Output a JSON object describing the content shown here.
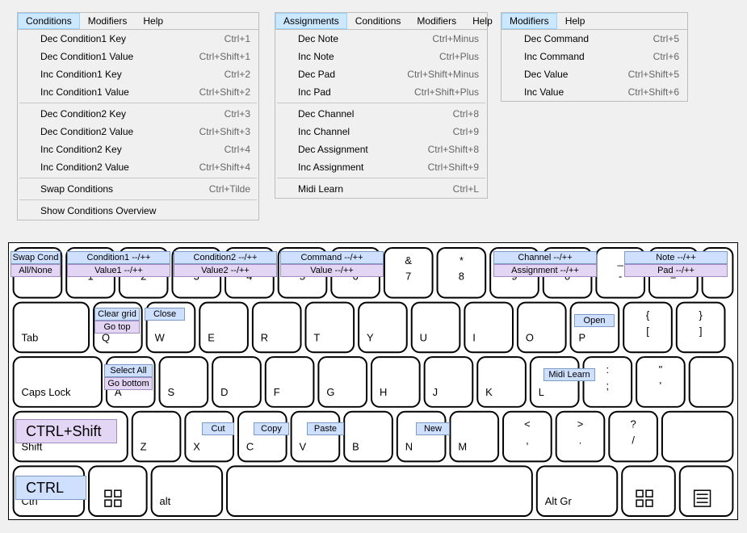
{
  "menus": {
    "conditions": {
      "bar": [
        "Conditions",
        "Modifiers",
        "Help"
      ],
      "selected": 0,
      "items": [
        {
          "label": "Dec Condition1 Key",
          "shortcut": "Ctrl+1"
        },
        {
          "label": "Dec Condition1 Value",
          "shortcut": "Ctrl+Shift+1"
        },
        {
          "label": "Inc Condition1 Key",
          "shortcut": "Ctrl+2"
        },
        {
          "label": "Inc Condition1 Value",
          "shortcut": "Ctrl+Shift+2"
        },
        {
          "sep": true
        },
        {
          "label": "Dec Condition2 Key",
          "shortcut": "Ctrl+3"
        },
        {
          "label": "Dec Condition2 Value",
          "shortcut": "Ctrl+Shift+3"
        },
        {
          "label": "Inc Condition2 Key",
          "shortcut": "Ctrl+4"
        },
        {
          "label": "Inc Condition2 Value",
          "shortcut": "Ctrl+Shift+4"
        },
        {
          "sep": true
        },
        {
          "label": "Swap Conditions",
          "shortcut": "Ctrl+Tilde"
        },
        {
          "sep": true
        },
        {
          "label": "Show Conditions Overview",
          "shortcut": ""
        }
      ]
    },
    "assignments": {
      "bar": [
        "Assignments",
        "Conditions",
        "Modifiers",
        "Help"
      ],
      "selected": 0,
      "items": [
        {
          "label": "Dec Note",
          "shortcut": "Ctrl+Minus"
        },
        {
          "label": "Inc Note",
          "shortcut": "Ctrl+Plus"
        },
        {
          "label": "Dec Pad",
          "shortcut": "Ctrl+Shift+Minus"
        },
        {
          "label": "Inc Pad",
          "shortcut": "Ctrl+Shift+Plus"
        },
        {
          "sep": true
        },
        {
          "label": "Dec Channel",
          "shortcut": "Ctrl+8"
        },
        {
          "label": "Inc Channel",
          "shortcut": "Ctrl+9"
        },
        {
          "label": "Dec Assignment",
          "shortcut": "Ctrl+Shift+8"
        },
        {
          "label": "Inc Assignment",
          "shortcut": "Ctrl+Shift+9"
        },
        {
          "sep": true
        },
        {
          "label": "Midi Learn",
          "shortcut": "Ctrl+L"
        }
      ]
    },
    "modifiers": {
      "bar": [
        "Modifiers",
        "Help"
      ],
      "selected": 0,
      "items": [
        {
          "label": "Dec Command",
          "shortcut": "Ctrl+5"
        },
        {
          "label": "Inc Command",
          "shortcut": "Ctrl+6"
        },
        {
          "label": "Dec Value",
          "shortcut": "Ctrl+Shift+5"
        },
        {
          "label": "Inc Value",
          "shortcut": "Ctrl+Shift+6"
        }
      ]
    }
  },
  "keyboard": {
    "row1_labels": [
      "!\n1",
      "@\n2",
      "#\n3",
      "$\n4",
      "%\n5",
      "^\n6",
      "&\n7",
      "*\n8",
      "(\n9",
      ")\n0",
      "_\n-",
      "+\n="
    ],
    "tab": "Tab",
    "row2": [
      "Q",
      "W",
      "E",
      "R",
      "T",
      "Y",
      "U",
      "I",
      "O",
      "P",
      "{\n[",
      "}\n]"
    ],
    "capslock": "Caps Lock",
    "row3": [
      "A",
      "S",
      "D",
      "F",
      "G",
      "H",
      "J",
      "K",
      "L",
      ":\n;",
      "\"\n'"
    ],
    "shift": "Shift",
    "row4": [
      "Z",
      "X",
      "C",
      "V",
      "B",
      "N",
      "M",
      "<\n,",
      ">\n.",
      "?\n/"
    ],
    "ctrl": "Ctrl",
    "alt": "alt",
    "altgr": "Alt Gr"
  },
  "overlays": {
    "row1": {
      "tilde_blue": "Swap Cond",
      "tilde_purple": "All/None",
      "k1_blue": "Condition1 --/++",
      "k1_purple": "Value1 --/++",
      "k3_blue": "Condition2 --/++",
      "k3_purple": "Value2 --/++",
      "k5_blue": "Command --/++",
      "k5_purple": "Value --/++",
      "k8_blue": "Channel --/++",
      "k8_purple": "Assignment --/++",
      "kminus_blue": "Note --/++",
      "kminus_purple": "Pad --/++"
    },
    "rowQ": {
      "q_blue": "Clear grid",
      "q_purple": "Go top",
      "w_blue": "Close",
      "o_blue": "Open"
    },
    "rowA": {
      "a_blue": "Select All",
      "a_purple": "Go bottom",
      "l_blue": "Midi Learn"
    },
    "rowZ": {
      "x_blue": "Cut",
      "c_blue": "Copy",
      "v_blue": "Paste",
      "n_blue": "New"
    },
    "big": {
      "ctrlshift": "CTRL+Shift",
      "ctrl": "CTRL"
    }
  }
}
